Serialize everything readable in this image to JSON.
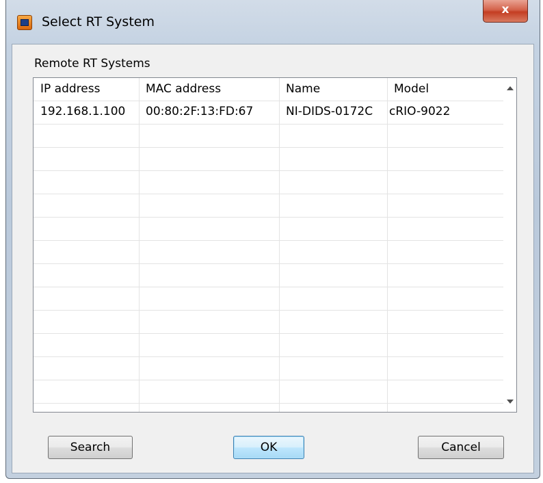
{
  "window": {
    "title": "Select RT System",
    "close_symbol": "x"
  },
  "group": {
    "label": "Remote RT Systems"
  },
  "table": {
    "columns": [
      "IP address",
      "MAC address",
      "Name",
      "Model"
    ],
    "rows": [
      [
        "192.168.1.100",
        "00:80:2F:13:FD:67",
        "NI-DIDS-0172C",
        "cRIO-9022"
      ]
    ]
  },
  "buttons": {
    "search": "Search",
    "ok": "OK",
    "cancel": "Cancel"
  },
  "icons": {
    "app": "labview-app-icon",
    "close": "close-icon",
    "scroll_up": "arrow-up-icon",
    "scroll_down": "arrow-down-icon"
  },
  "colors": {
    "default_button_border": "#3c7fb1",
    "close_button": "#c43d22"
  }
}
